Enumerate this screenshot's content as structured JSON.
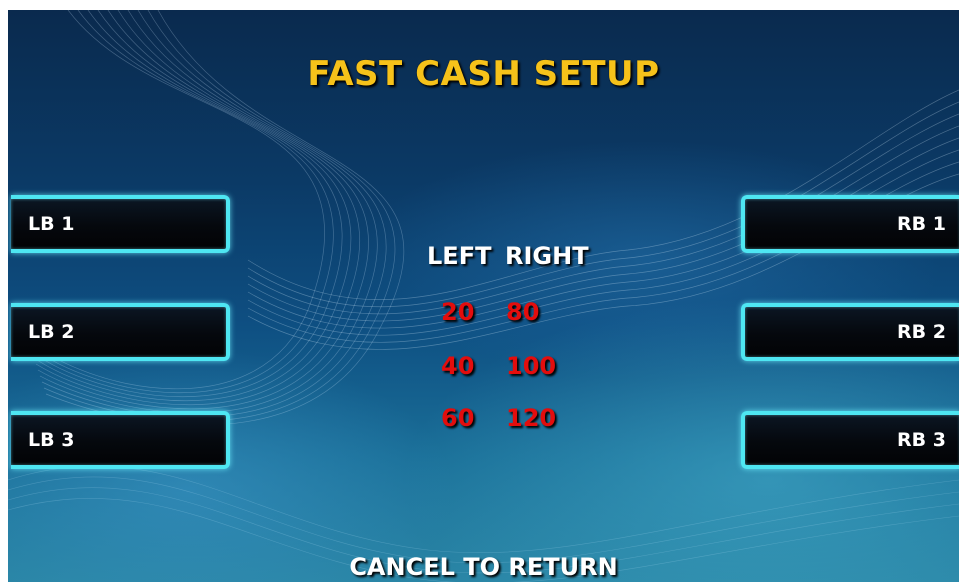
{
  "screen": {
    "title": "FAST CASH SETUP",
    "footer": "CANCEL TO RETURN"
  },
  "buttons": {
    "left": [
      "LB 1",
      "LB 2",
      "LB 3"
    ],
    "right": [
      "RB 1",
      "RB 2",
      "RB 3"
    ]
  },
  "amounts": {
    "left_header": "LEFT",
    "right_header": "RIGHT",
    "left_values": [
      "20",
      "40",
      "60"
    ],
    "right_values": [
      "80",
      "100",
      "120"
    ]
  },
  "colors": {
    "title": "#f6c21a",
    "amount_values": "#e30d0d",
    "button_border": "#4ee6f2",
    "background": "#0e4f82"
  }
}
